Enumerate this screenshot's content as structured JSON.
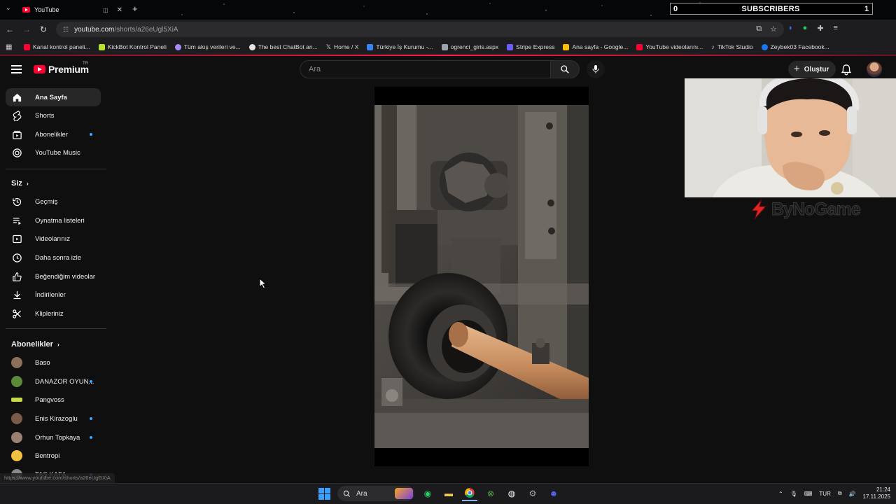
{
  "browser": {
    "tab_title": "YouTube",
    "tab_close": "✕",
    "new_tab": "+",
    "url_host": "youtube.com",
    "url_path": "/shorts/a26eUgl5XiA",
    "bookmarks": [
      {
        "label": "Kanal kontrol paneli...",
        "color": "#ff0033"
      },
      {
        "label": "KickBot Kontrol Paneli",
        "color": "#b6e32a"
      },
      {
        "label": "Tüm akış verileri ve...",
        "color": "#a78bfa"
      },
      {
        "label": "The best ChatBot an...",
        "color": "#e5e5e5"
      },
      {
        "label": "Home / X",
        "color": "#ffffff"
      },
      {
        "label": "Türkiye İş Kurumu -...",
        "color": "#3b82f6"
      },
      {
        "label": "ogrenci_giris.aspx",
        "color": "#9ca3af"
      },
      {
        "label": "Stripe Express",
        "color": "#6d5dfc"
      },
      {
        "label": "Ana sayfa - Google...",
        "color": "#fbbc05"
      },
      {
        "label": "YouTube videolarını...",
        "color": "#ff0033"
      },
      {
        "label": "TikTok Studio",
        "color": "#e5e5e5"
      },
      {
        "label": "Zeybek03 Facebook...",
        "color": "#1877f2"
      }
    ]
  },
  "subscriber_widget": {
    "count": "0",
    "label": "SUBSCRIBERS",
    "right": "1"
  },
  "header": {
    "logo_text": "Premium",
    "logo_region": "TR",
    "search_placeholder": "Ara",
    "create_label": "Oluştur"
  },
  "sidebar": {
    "main": [
      {
        "label": "Ana Sayfa",
        "icon": "home-icon"
      },
      {
        "label": "Shorts",
        "icon": "shorts-icon"
      },
      {
        "label": "Abonelikler",
        "icon": "subscriptions-icon"
      },
      {
        "label": "YouTube Music",
        "icon": "music-icon"
      }
    ],
    "you_heading": "Siz",
    "you": [
      {
        "label": "Geçmiş",
        "icon": "history-icon"
      },
      {
        "label": "Oynatma listeleri",
        "icon": "playlists-icon"
      },
      {
        "label": "Videolarınız",
        "icon": "your-videos-icon"
      },
      {
        "label": "Daha sonra izle",
        "icon": "watch-later-icon"
      },
      {
        "label": "Beğendiğim videolar",
        "icon": "liked-icon"
      },
      {
        "label": "İndirilenler",
        "icon": "downloads-icon"
      },
      {
        "label": "Klipleriniz",
        "icon": "clips-icon"
      }
    ],
    "subs_heading": "Abonelikler",
    "channels": [
      {
        "label": "Baso",
        "color": "#8a6f5a"
      },
      {
        "label": "DANAZOR OYUN...",
        "color": "#5a8a3a"
      },
      {
        "label": "Pangvoss",
        "color": "#c8d84a"
      },
      {
        "label": "Enis Kirazoglu",
        "color": "#7a5a4a"
      },
      {
        "label": "Orhun Topkaya",
        "color": "#9a8070"
      },
      {
        "label": "Bentropi",
        "color": "#f0c040"
      },
      {
        "label": "TAŞ KAFA",
        "color": "#888888"
      }
    ]
  },
  "status_url": "https://www.youtube.com/shorts/a26eUgl5XiA",
  "overlay": {
    "watermark": "ByNoGame"
  },
  "taskbar": {
    "search_label": "Ara",
    "lang": "TUR",
    "time": "21:24",
    "date": "17.11.2025"
  }
}
